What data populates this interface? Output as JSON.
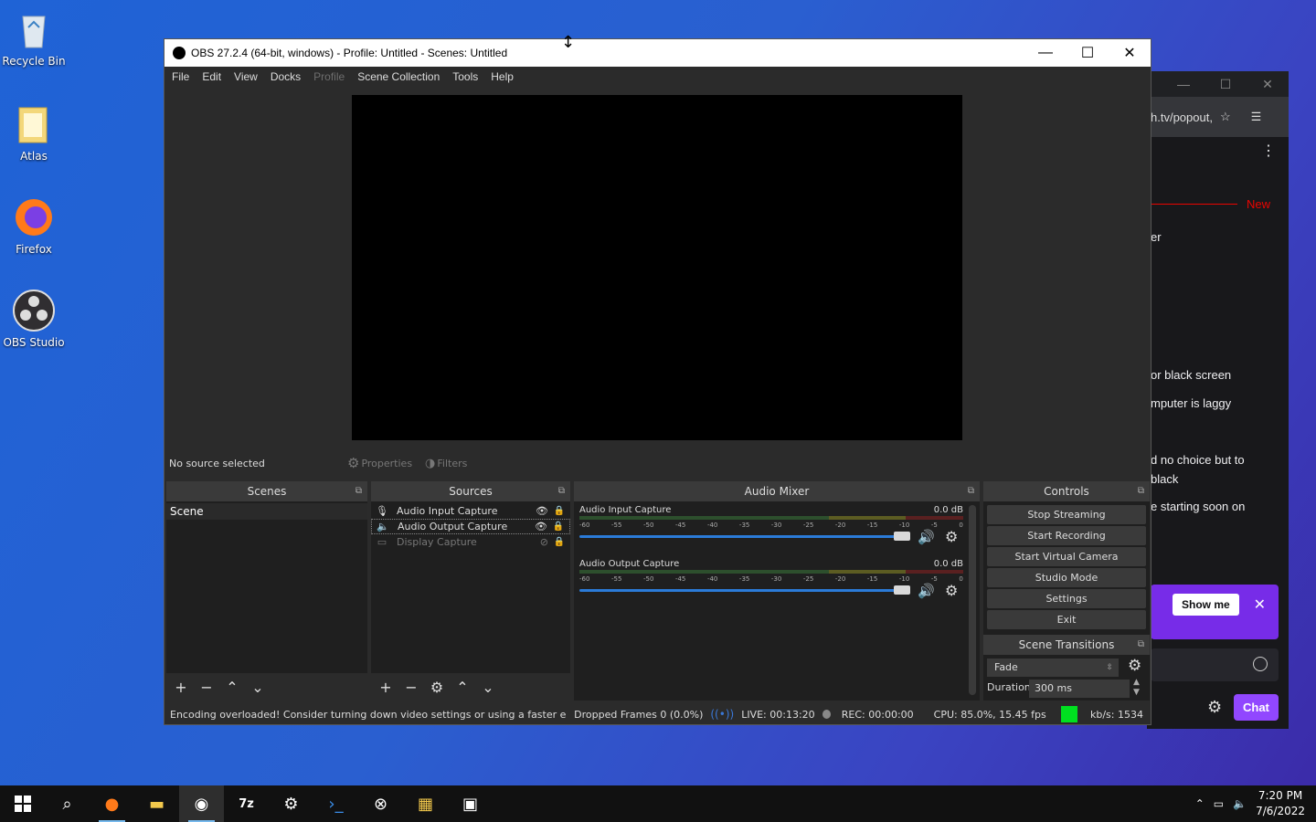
{
  "desktop": {
    "icons": [
      {
        "label": "Recycle Bin",
        "icon": "recycle-bin-icon"
      },
      {
        "label": "Atlas",
        "icon": "folder-icon"
      },
      {
        "label": "Firefox",
        "icon": "firefox-icon"
      },
      {
        "label": "OBS Studio",
        "icon": "obs-icon"
      }
    ]
  },
  "browser": {
    "url": "h.tv/popout,",
    "new_label": "New",
    "messages": [
      "er",
      "or black screen",
      "mputer is laggy",
      "d no choice but to",
      "black",
      "e starting soon on"
    ],
    "promo_button": "Show me",
    "chat_button": "Chat"
  },
  "obs": {
    "title": "OBS 27.2.4 (64-bit, windows) - Profile: Untitled - Scenes: Untitled",
    "menu": [
      "File",
      "Edit",
      "View",
      "Docks",
      "Profile",
      "Scene Collection",
      "Tools",
      "Help"
    ],
    "no_source": "No source selected",
    "properties_label": "Properties",
    "filters_label": "Filters",
    "docks": {
      "scenes_title": "Scenes",
      "sources_title": "Sources",
      "mixer_title": "Audio Mixer",
      "controls_title": "Controls",
      "transitions_title": "Scene Transitions"
    },
    "scenes": [
      "Scene"
    ],
    "sources": [
      {
        "name": "Audio Input Capture",
        "icon": "microphone-icon",
        "visible": true
      },
      {
        "name": "Audio Output Capture",
        "icon": "speaker-icon",
        "visible": true
      },
      {
        "name": "Display Capture",
        "icon": "monitor-icon",
        "visible": false
      }
    ],
    "mixer": [
      {
        "name": "Audio Input Capture",
        "db": "0.0 dB"
      },
      {
        "name": "Audio Output Capture",
        "db": "0.0 dB"
      }
    ],
    "meter_ticks": [
      "-60",
      "-55",
      "-50",
      "-45",
      "-40",
      "-35",
      "-30",
      "-25",
      "-20",
      "-15",
      "-10",
      "-5",
      "0"
    ],
    "controls": [
      "Stop Streaming",
      "Start Recording",
      "Start Virtual Camera",
      "Studio Mode",
      "Settings",
      "Exit"
    ],
    "transition": "Fade",
    "duration_label": "Duration",
    "duration_value": "300 ms",
    "status": {
      "warning": "Encoding overloaded! Consider turning down video settings or using a faster encoding",
      "dropped": "Dropped Frames 0 (0.0%)",
      "live": "LIVE: 00:13:20",
      "rec": "REC: 00:00:00",
      "cpu": "CPU: 85.0%, 15.45 fps",
      "kbps": "kb/s: 1534",
      "indicator_color": "#00e020"
    }
  },
  "taskbar": {
    "time": "7:20 PM",
    "date": "7/6/2022"
  }
}
